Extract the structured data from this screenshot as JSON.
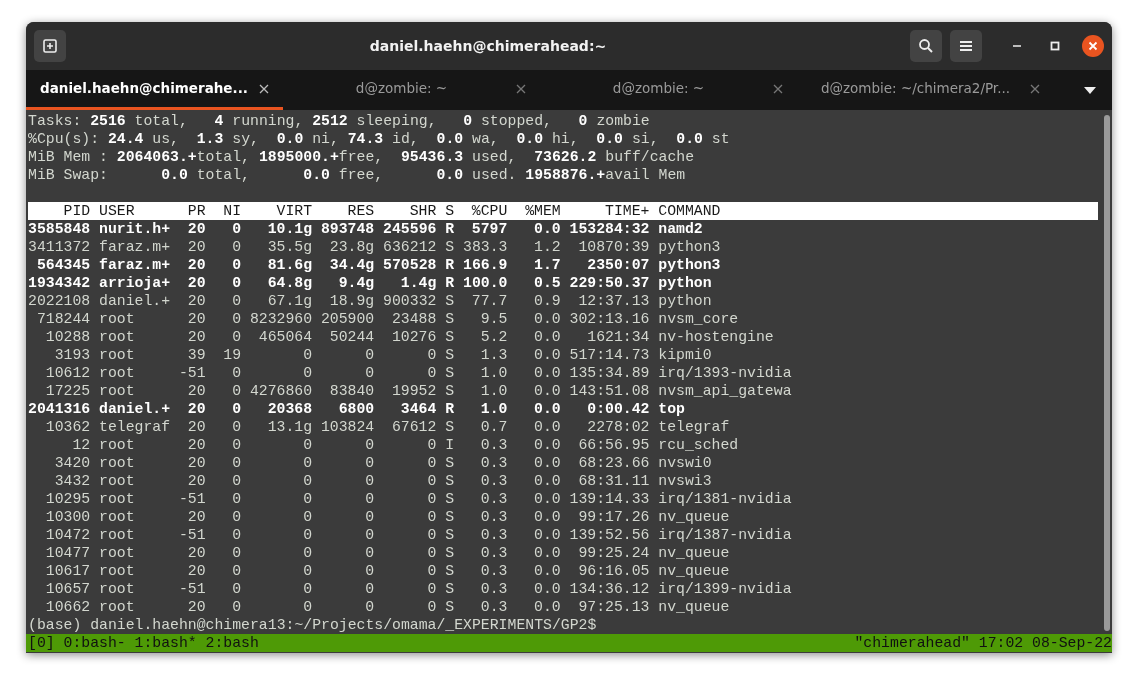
{
  "window": {
    "title": "daniel.haehn@chimerahead:~"
  },
  "tabs": [
    {
      "label": "daniel.haehn@chimerahe...",
      "selected": true
    },
    {
      "label": "d@zombie: ~",
      "selected": false
    },
    {
      "label": "d@zombie: ~",
      "selected": false
    },
    {
      "label": "d@zombie: ~/chimera2/Pr...",
      "selected": false
    }
  ],
  "terminal": {
    "summary_lines": [
      "Tasks: **2516** total,   **4** running, **2512** sleeping,   **0** stopped,   **0** zombie",
      "%Cpu(s): **24.4** us,  **1.3** sy,  **0.0** ni, **74.3** id,  **0.0** wa,  **0.0** hi,  **0.0** si,  **0.0** st",
      "MiB Mem : **2064063.+**total, **1895000.+**free,  **95436.3** used,  **73626.2** buff/cache",
      "MiB Swap:      **0.0** total,      **0.0** free,      **0.0** used. **1958876.+**avail Mem"
    ],
    "table": {
      "columns": [
        "PID",
        "USER",
        "PR",
        "NI",
        "VIRT",
        "RES",
        "SHR",
        "S",
        "%CPU",
        "%MEM",
        "TIME+",
        "COMMAND"
      ],
      "rows": [
        {
          "highlighted": true,
          "cells": [
            "3585848",
            "nurit.h+",
            "20",
            "0",
            "10.1g",
            "893748",
            "245596",
            "R",
            "5797",
            "0.0",
            "153284:32",
            "namd2"
          ]
        },
        {
          "highlighted": false,
          "cells": [
            "3411372",
            "faraz.m+",
            "20",
            "0",
            "35.5g",
            "23.8g",
            "636212",
            "S",
            "383.3",
            "1.2",
            "10870:39",
            "python3"
          ]
        },
        {
          "highlighted": true,
          "cells": [
            "564345",
            "faraz.m+",
            "20",
            "0",
            "81.6g",
            "34.4g",
            "570528",
            "R",
            "166.9",
            "1.7",
            "2350:07",
            "python3"
          ]
        },
        {
          "highlighted": true,
          "cells": [
            "1934342",
            "arrioja+",
            "20",
            "0",
            "64.8g",
            "9.4g",
            "1.4g",
            "R",
            "100.0",
            "0.5",
            "229:50.37",
            "python"
          ]
        },
        {
          "highlighted": false,
          "cells": [
            "2022108",
            "daniel.+",
            "20",
            "0",
            "67.1g",
            "18.9g",
            "900332",
            "S",
            "77.7",
            "0.9",
            "12:37.13",
            "python"
          ]
        },
        {
          "highlighted": false,
          "cells": [
            "718244",
            "root",
            "20",
            "0",
            "8232960",
            "205900",
            "23488",
            "S",
            "9.5",
            "0.0",
            "302:13.16",
            "nvsm_core"
          ]
        },
        {
          "highlighted": false,
          "cells": [
            "10288",
            "root",
            "20",
            "0",
            "465064",
            "50244",
            "10276",
            "S",
            "5.2",
            "0.0",
            "1621:34",
            "nv-hostengine"
          ]
        },
        {
          "highlighted": false,
          "cells": [
            "3193",
            "root",
            "39",
            "19",
            "0",
            "0",
            "0",
            "S",
            "1.3",
            "0.0",
            "517:14.73",
            "kipmi0"
          ]
        },
        {
          "highlighted": false,
          "cells": [
            "10612",
            "root",
            "-51",
            "0",
            "0",
            "0",
            "0",
            "S",
            "1.0",
            "0.0",
            "135:34.89",
            "irq/1393-nvidia"
          ]
        },
        {
          "highlighted": false,
          "cells": [
            "17225",
            "root",
            "20",
            "0",
            "4276860",
            "83840",
            "19952",
            "S",
            "1.0",
            "0.0",
            "143:51.08",
            "nvsm_api_gatewa"
          ]
        },
        {
          "highlighted": true,
          "cells": [
            "2041316",
            "daniel.+",
            "20",
            "0",
            "20368",
            "6800",
            "3464",
            "R",
            "1.0",
            "0.0",
            "0:00.42",
            "top"
          ]
        },
        {
          "highlighted": false,
          "cells": [
            "10362",
            "telegraf",
            "20",
            "0",
            "13.1g",
            "103824",
            "67612",
            "S",
            "0.7",
            "0.0",
            "2278:02",
            "telegraf"
          ]
        },
        {
          "highlighted": false,
          "cells": [
            "12",
            "root",
            "20",
            "0",
            "0",
            "0",
            "0",
            "I",
            "0.3",
            "0.0",
            "66:56.95",
            "rcu_sched"
          ]
        },
        {
          "highlighted": false,
          "cells": [
            "3420",
            "root",
            "20",
            "0",
            "0",
            "0",
            "0",
            "S",
            "0.3",
            "0.0",
            "68:23.66",
            "nvswi0"
          ]
        },
        {
          "highlighted": false,
          "cells": [
            "3432",
            "root",
            "20",
            "0",
            "0",
            "0",
            "0",
            "S",
            "0.3",
            "0.0",
            "68:31.11",
            "nvswi3"
          ]
        },
        {
          "highlighted": false,
          "cells": [
            "10295",
            "root",
            "-51",
            "0",
            "0",
            "0",
            "0",
            "S",
            "0.3",
            "0.0",
            "139:14.33",
            "irq/1381-nvidia"
          ]
        },
        {
          "highlighted": false,
          "cells": [
            "10300",
            "root",
            "20",
            "0",
            "0",
            "0",
            "0",
            "S",
            "0.3",
            "0.0",
            "99:17.26",
            "nv_queue"
          ]
        },
        {
          "highlighted": false,
          "cells": [
            "10472",
            "root",
            "-51",
            "0",
            "0",
            "0",
            "0",
            "S",
            "0.3",
            "0.0",
            "139:52.56",
            "irq/1387-nvidia"
          ]
        },
        {
          "highlighted": false,
          "cells": [
            "10477",
            "root",
            "20",
            "0",
            "0",
            "0",
            "0",
            "S",
            "0.3",
            "0.0",
            "99:25.24",
            "nv_queue"
          ]
        },
        {
          "highlighted": false,
          "cells": [
            "10617",
            "root",
            "20",
            "0",
            "0",
            "0",
            "0",
            "S",
            "0.3",
            "0.0",
            "96:16.05",
            "nv_queue"
          ]
        },
        {
          "highlighted": false,
          "cells": [
            "10657",
            "root",
            "-51",
            "0",
            "0",
            "0",
            "0",
            "S",
            "0.3",
            "0.0",
            "134:36.12",
            "irq/1399-nvidia"
          ]
        },
        {
          "highlighted": false,
          "cells": [
            "10662",
            "root",
            "20",
            "0",
            "0",
            "0",
            "0",
            "S",
            "0.3",
            "0.0",
            "97:25.13",
            "nv_queue"
          ]
        }
      ]
    },
    "prompt": "(base) daniel.haehn@chimera13:~/Projects/omama/_EXPERIMENTS/GP2$"
  },
  "status_bar": {
    "left": "[0] 0:bash- 1:bash* 2:bash",
    "right": "\"chimerahead\" 17:02 08-Sep-22"
  }
}
